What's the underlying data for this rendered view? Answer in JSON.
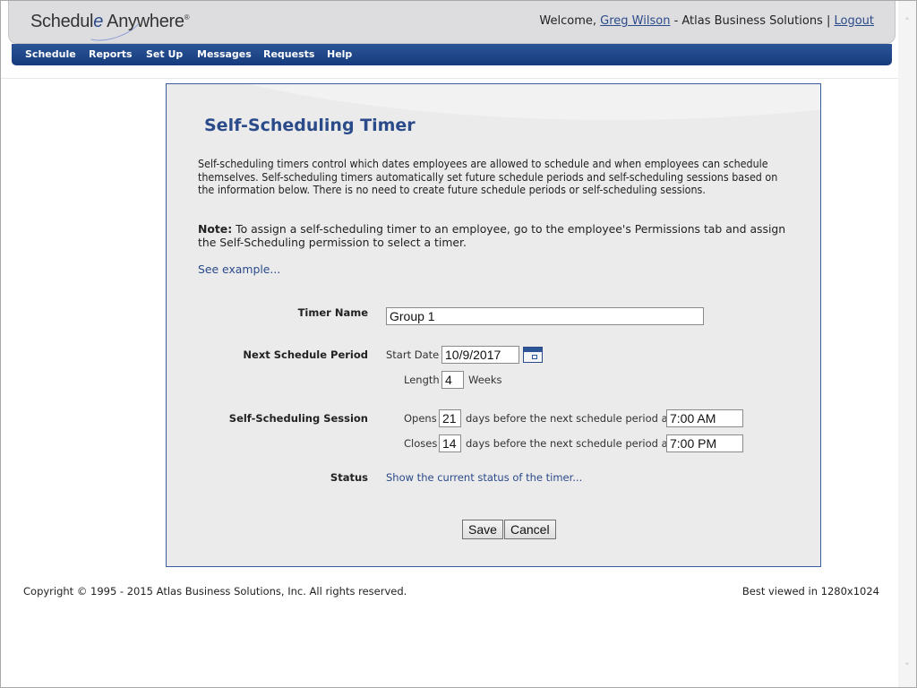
{
  "header": {
    "logo_part1": "Schedul",
    "logo_e": "e",
    "logo_part2": " Anywhere",
    "logo_reg": "®",
    "welcome_prefix": "Welcome, ",
    "user_name": "Greg Wilson",
    "company_text": " - Atlas Business Solutions | ",
    "logout_label": "Logout"
  },
  "nav": {
    "items": [
      {
        "label": "Schedule"
      },
      {
        "label": "Reports"
      },
      {
        "label": "Set Up"
      },
      {
        "label": "Messages"
      },
      {
        "label": "Requests"
      },
      {
        "label": "Help"
      }
    ]
  },
  "panel": {
    "title": "Self-Scheduling Timer",
    "description": "Self-scheduling timers control which dates employees are allowed to schedule and when employees can schedule themselves. Self-scheduling timers automatically set future schedule periods and self-scheduling sessions based on the information below. There is no need to create future schedule periods or self-scheduling sessions.",
    "note_label": "Note:",
    "note_text": " To assign a self-scheduling timer to an employee, go to the employee's Permissions tab and assign the Self-Scheduling permission to select a timer.",
    "see_example": "See example..."
  },
  "form": {
    "timer_name_label": "Timer Name",
    "timer_name_value": "Group 1",
    "next_period_label": "Next Schedule Period",
    "start_date_label": "Start Date",
    "start_date_value": "10/9/2017",
    "length_label": "Length",
    "length_value": "4",
    "length_unit": "Weeks",
    "session_label": "Self-Scheduling Session",
    "opens_label": "Opens",
    "opens_days": "21",
    "opens_text": "days before the next schedule period at",
    "opens_time": "7:00 AM",
    "closes_label": "Closes",
    "closes_days": "14",
    "closes_text": "days before the next schedule period at",
    "closes_time": "7:00 PM",
    "status_label": "Status",
    "status_link": "Show the current status of the timer...",
    "save_label": "Save",
    "cancel_label": "Cancel"
  },
  "footer": {
    "copyright": "Copyright © 1995 - 2015 Atlas Business Solutions, Inc. All rights reserved.",
    "best_viewed": "Best viewed in 1280x1024"
  },
  "scrollbar": {
    "up_icon": "˄",
    "down_icon": "˅"
  }
}
